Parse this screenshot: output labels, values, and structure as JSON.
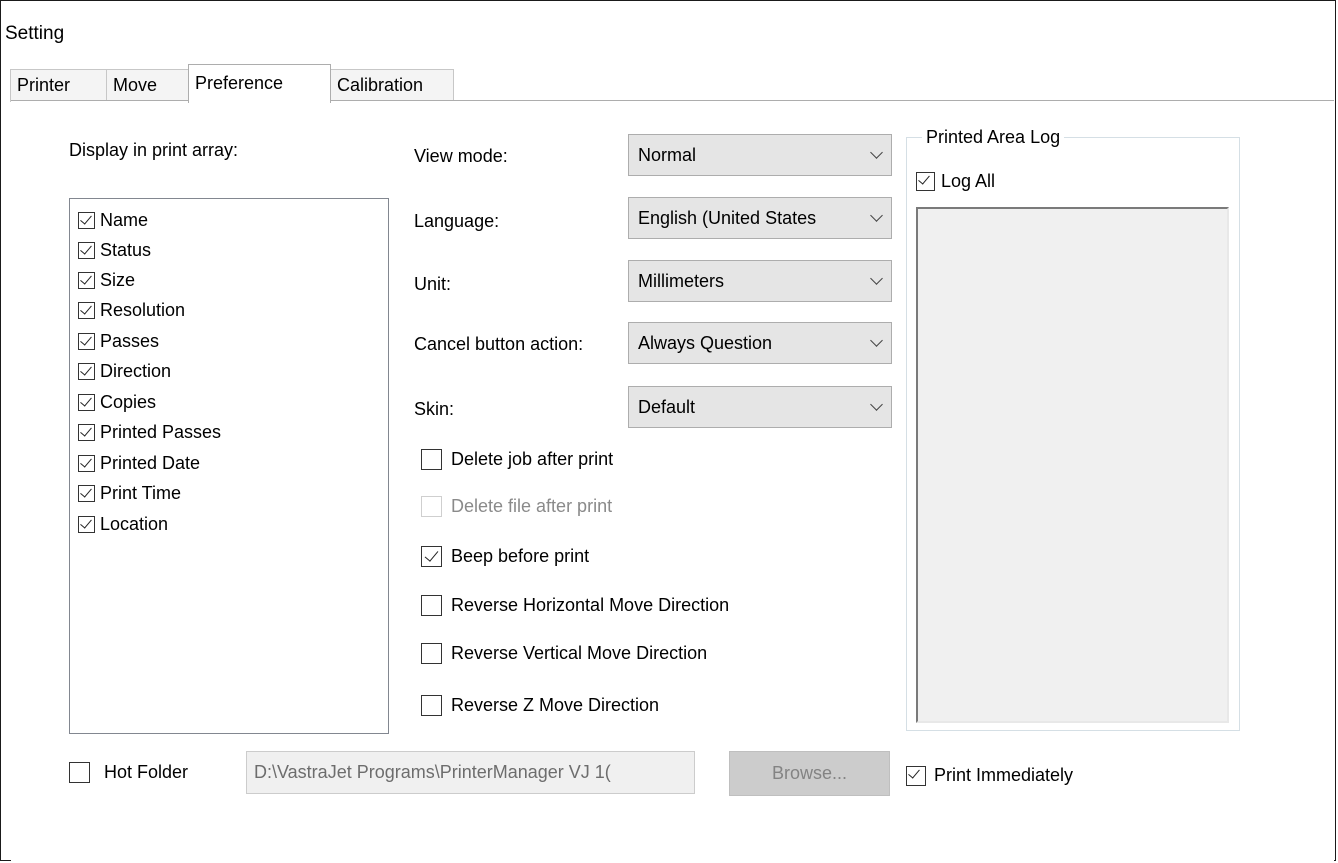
{
  "window": {
    "title": "Setting"
  },
  "tabs": [
    {
      "label": "Printer",
      "active": false
    },
    {
      "label": "Move",
      "active": false
    },
    {
      "label": "Preference",
      "active": true
    },
    {
      "label": "Calibration",
      "active": false
    }
  ],
  "display_array": {
    "label": "Display in print array:",
    "items": [
      {
        "label": "Name",
        "checked": true
      },
      {
        "label": "Status",
        "checked": true
      },
      {
        "label": "Size",
        "checked": true
      },
      {
        "label": "Resolution",
        "checked": true
      },
      {
        "label": "Passes",
        "checked": true
      },
      {
        "label": "Direction",
        "checked": true
      },
      {
        "label": "Copies",
        "checked": true
      },
      {
        "label": "Printed Passes",
        "checked": true
      },
      {
        "label": "Printed Date",
        "checked": true
      },
      {
        "label": "Print Time",
        "checked": true
      },
      {
        "label": "Location",
        "checked": true
      }
    ]
  },
  "settings": {
    "view_mode": {
      "label": "View mode:",
      "value": "Normal"
    },
    "language": {
      "label": "Language:",
      "value": "English (United States"
    },
    "unit": {
      "label": "Unit:",
      "value": "Millimeters"
    },
    "cancel_action": {
      "label": "Cancel button action:",
      "value": "Always Question"
    },
    "skin": {
      "label": "Skin:",
      "value": "Default"
    }
  },
  "options": {
    "delete_job": {
      "label": "Delete job after print",
      "checked": false,
      "enabled": true
    },
    "delete_file": {
      "label": "Delete file after print",
      "checked": false,
      "enabled": false
    },
    "beep": {
      "label": "Beep before print",
      "checked": true,
      "enabled": true
    },
    "reverse_h": {
      "label": "Reverse Horizontal Move Direction",
      "checked": false,
      "enabled": true
    },
    "reverse_v": {
      "label": "Reverse Vertical Move Direction",
      "checked": false,
      "enabled": true
    },
    "reverse_z": {
      "label": "Reverse Z Move Direction",
      "checked": false,
      "enabled": true
    }
  },
  "printed_area_log": {
    "title": "Printed Area Log",
    "log_all": {
      "label": "Log All",
      "checked": true
    }
  },
  "hot_folder": {
    "label": "Hot Folder",
    "checked": false,
    "path": "D:\\VastraJet Programs\\PrinterManager VJ 1(",
    "browse_label": "Browse...",
    "print_immediately": {
      "label": "Print Immediately",
      "checked": true
    }
  }
}
